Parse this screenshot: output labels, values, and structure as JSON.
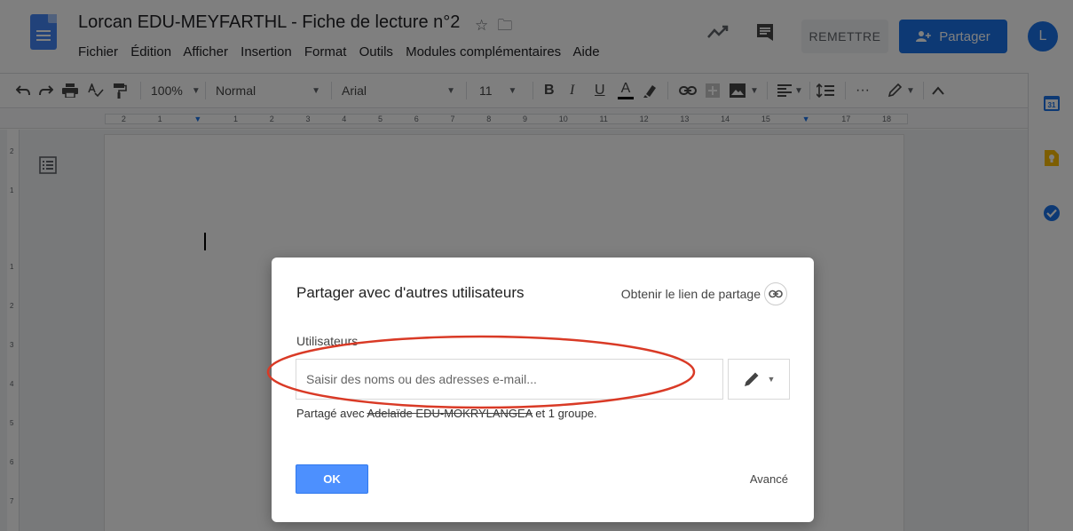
{
  "header": {
    "title": "Lorcan EDU-MEYFARTHL - Fiche de lecture n°2",
    "title_icons": [
      "star-icon",
      "move-folder-icon"
    ],
    "menu": [
      "Fichier",
      "Édition",
      "Afficher",
      "Insertion",
      "Format",
      "Outils",
      "Modules complémentaires",
      "Aide"
    ],
    "remettre_label": "REMETTRE",
    "share_label": "Partager",
    "avatar_letter": "L"
  },
  "toolbar": {
    "zoom": "100%",
    "style": "Normal",
    "font": "Arial",
    "font_size": "11",
    "bold": "B",
    "italic": "I",
    "underline": "U",
    "text_color": "A",
    "more": "···"
  },
  "ruler": {
    "ticks": [
      "2",
      "1",
      "",
      "1",
      "2",
      "3",
      "4",
      "5",
      "6",
      "7",
      "8",
      "9",
      "10",
      "11",
      "12",
      "13",
      "14",
      "15",
      "16",
      "17",
      "18"
    ]
  },
  "vruler": {
    "ticks": [
      "2",
      "1",
      "",
      "1",
      "2",
      "3",
      "4",
      "5",
      "6",
      "7"
    ]
  },
  "dialog": {
    "title": "Partager avec d'autres utilisateurs",
    "share_link": "Obtenir le lien de partage",
    "users_label": "Utilisateurs",
    "input_placeholder": "Saisir des noms ou des adresses e-mail...",
    "shared_prefix": "Partagé avec ",
    "shared_name": "Adelaïde EDU-MOKRYLANGEA",
    "shared_suffix": " et 1 groupe.",
    "ok_label": "OK",
    "advanced_label": "Avancé"
  },
  "colors": {
    "brand_blue": "#1a73e8",
    "ok_blue": "#4d90fe",
    "annotation_red": "#d93a26"
  }
}
